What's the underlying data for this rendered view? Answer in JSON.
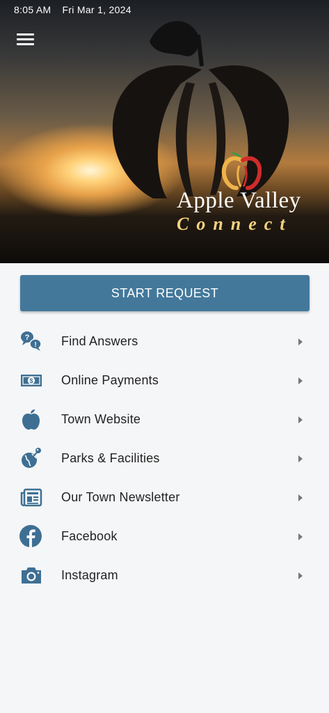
{
  "status_bar": {
    "time": "8:05 AM",
    "date": "Fri Mar 1, 2024"
  },
  "header": {
    "menu_icon": "hamburger-menu-icon",
    "logo_title": "Apple Valley",
    "logo_subtitle": "Connect"
  },
  "start_request": {
    "label": "START REQUEST"
  },
  "menu": {
    "items": [
      {
        "label": "Find Answers",
        "icon": "question-chat-icon"
      },
      {
        "label": "Online Payments",
        "icon": "money-bill-icon"
      },
      {
        "label": "Town Website",
        "icon": "apple-icon"
      },
      {
        "label": "Parks & Facilities",
        "icon": "globe-icon"
      },
      {
        "label": "Our Town Newsletter",
        "icon": "newspaper-icon"
      },
      {
        "label": "Facebook",
        "icon": "facebook-icon"
      },
      {
        "label": "Instagram",
        "icon": "camera-icon"
      }
    ]
  },
  "colors": {
    "accent": "#43789b",
    "icon": "#3e6f93",
    "chevron": "#777777",
    "background": "#f5f6f8"
  }
}
